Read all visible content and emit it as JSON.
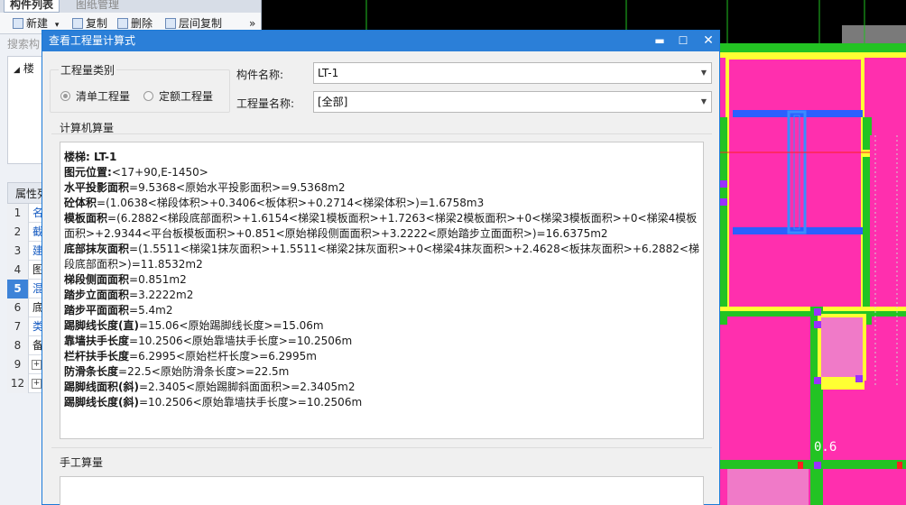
{
  "left_panel": {
    "tabs": [
      "构件列表",
      "图纸管理"
    ],
    "toolbar": {
      "new": "新建",
      "new_arrow": "▾",
      "copy": "复制",
      "delete": "删除",
      "floor_copy": "层间复制",
      "more": "»"
    },
    "search_placeholder": "搜索构",
    "tree_item": "楼",
    "prop_header": "属性列",
    "rows": [
      {
        "num": "1",
        "name": "名"
      },
      {
        "num": "2",
        "name": "截"
      },
      {
        "num": "3",
        "name": "建"
      },
      {
        "num": "4",
        "name": "图"
      },
      {
        "num": "5",
        "name": "混"
      },
      {
        "num": "6",
        "name": "底"
      },
      {
        "num": "7",
        "name": "类"
      },
      {
        "num": "8",
        "name": "备"
      },
      {
        "num": "9",
        "name": "+"
      },
      {
        "num": "12",
        "name": "+"
      }
    ]
  },
  "cad": {
    "label": "0.6"
  },
  "dialog": {
    "title": "查看工程量计算式",
    "buttons": {
      "minimize": "▬",
      "maximize": "☐",
      "close": "✕"
    },
    "qty_type": {
      "title": "工程量类别",
      "options": [
        "清单工程量",
        "定额工程量"
      ],
      "selected": "清单工程量"
    },
    "component_name_label": "构件名称:",
    "component_name_value": "LT-1",
    "qty_name_label": "工程量名称:",
    "qty_name_value": "[全部]",
    "computer_section": "计算机算量",
    "manual_section": "手工算量",
    "lines": [
      {
        "k": "楼梯: LT-1",
        "v": ""
      },
      {
        "k": "图元位置:",
        "v": "<17+90,E-1450>"
      },
      {
        "k": "水平投影面积",
        "v": "=9.5368<原始水平投影面积>=9.5368m2"
      },
      {
        "k": "砼体积",
        "v": "=(1.0638<梯段体积>+0.3406<板体积>+0.2714<梯梁体积>)=1.6758m3"
      },
      {
        "k": "模板面积",
        "v": "=(6.2882<梯段底部面积>+1.6154<梯梁1模板面积>+1.7263<梯梁2模板面积>+0<梯梁3模板面积>+0<梯梁4模板面积>+2.9344<平台板模板面积>+0.851<原始梯段侧面面积>+3.2222<原始踏步立面面积>)=16.6375m2"
      },
      {
        "k": "底部抹灰面积",
        "v": "=(1.5511<梯梁1抹灰面积>+1.5511<梯梁2抹灰面积>+0<梯梁4抹灰面积>+2.4628<板抹灰面积>+6.2882<梯段底部面积>)=11.8532m2"
      },
      {
        "k": "梯段侧面面积",
        "v": "=0.851m2"
      },
      {
        "k": "踏步立面面积",
        "v": "=3.2222m2"
      },
      {
        "k": "踏步平面面积",
        "v": "=5.4m2"
      },
      {
        "k": "踢脚线长度(直)",
        "v": "=15.06<原始踢脚线长度>=15.06m"
      },
      {
        "k": "靠墙扶手长度",
        "v": "=10.2506<原始靠墙扶手长度>=10.2506m"
      },
      {
        "k": "栏杆扶手长度",
        "v": "=6.2995<原始栏杆长度>=6.2995m"
      },
      {
        "k": "防滑条长度",
        "v": "=22.5<原始防滑条长度>=22.5m"
      },
      {
        "k": "踢脚线面积(斜)",
        "v": "=2.3405<原始踢脚斜面面积>=2.3405m2"
      },
      {
        "k": "踢脚线长度(斜)",
        "v": "=10.2506<原始靠墙扶手长度>=10.2506m"
      }
    ]
  },
  "colors": {
    "titlebar": "#2b7fd8",
    "selected_row": "#3d83d8",
    "cad_magenta": "#ff2fae",
    "cad_green": "#23c323",
    "cad_yellow": "#ffff33",
    "cad_blue": "#2b5fff"
  }
}
